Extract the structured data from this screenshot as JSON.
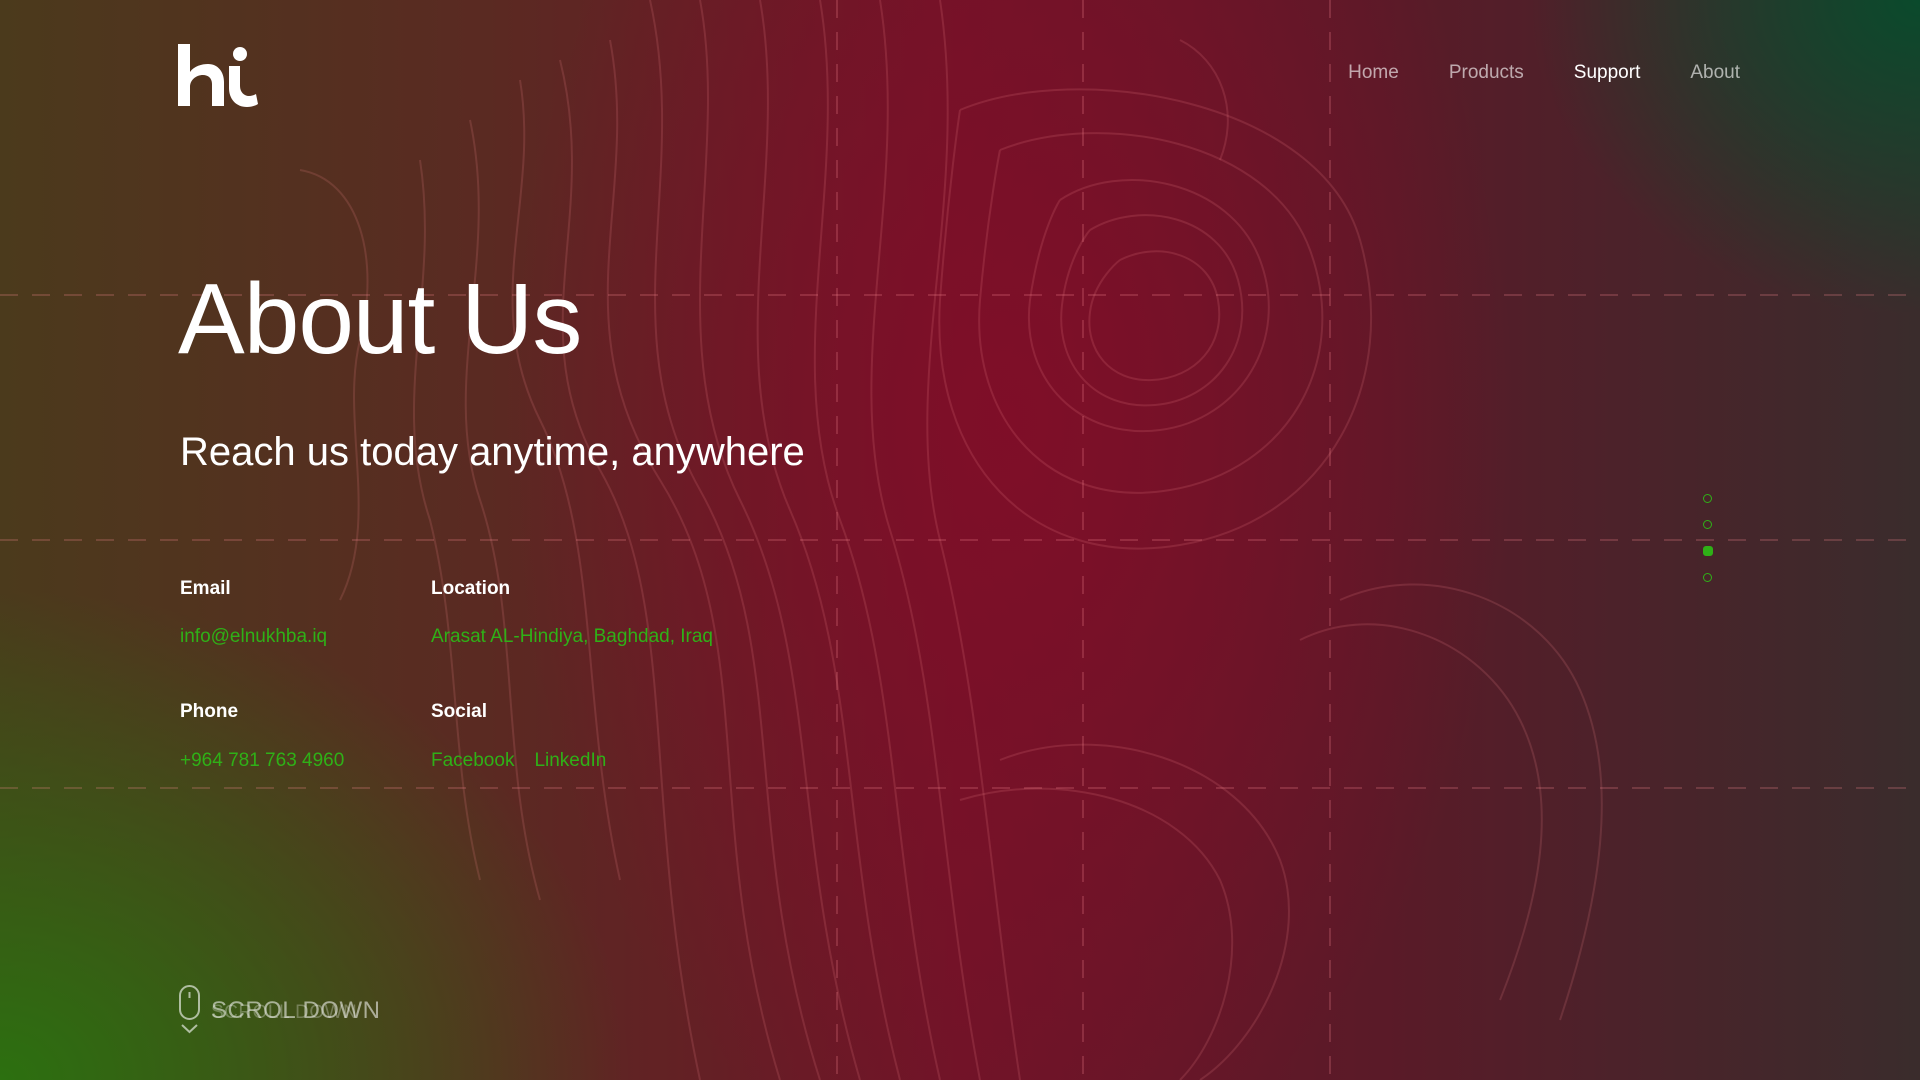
{
  "nav": {
    "items": [
      {
        "label": "Home"
      },
      {
        "label": "Products"
      },
      {
        "label": "Support"
      },
      {
        "label": "About"
      }
    ],
    "active_item": "Support"
  },
  "hero": {
    "title": "About Us",
    "subtitle": "Reach us today anytime, anywhere"
  },
  "contact": {
    "email_label": "Email",
    "email_value": "info@elnukhba.iq",
    "location_label": "Location",
    "location_value": "Arasat AL-Hindiya, Baghdad, Iraq",
    "phone_label": "Phone",
    "phone_value": "+964 781 763 4960",
    "social_label": "Social",
    "social_links": [
      {
        "label": "Facebook"
      },
      {
        "label": "LinkedIn"
      }
    ]
  },
  "pagination": {
    "total": 4,
    "active_index": 2
  },
  "scroll": {
    "label": "SCROL DOWN",
    "ghost_label": "SCROLL DOWN",
    "icon": "mouse-icon"
  },
  "colors": {
    "accent": "#2fb017",
    "crimson": "#7a0f26",
    "green_corner": "#2c7010",
    "text": "#ffffff"
  }
}
